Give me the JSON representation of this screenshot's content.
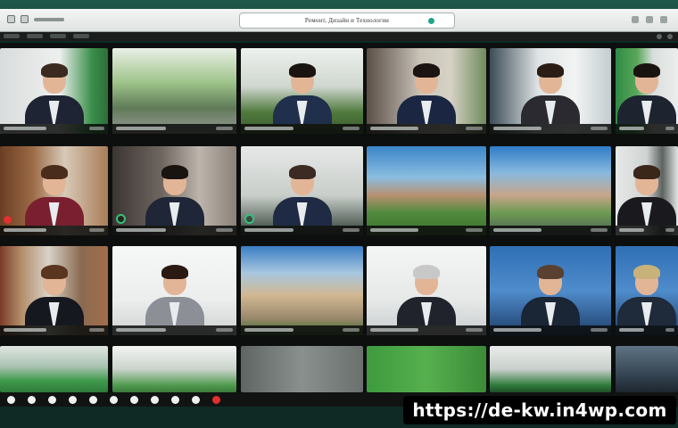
{
  "window": {
    "address_text": "Ремонт, Дизайн и Технологии"
  },
  "watermark": {
    "text": "https://de-kw.in4wp.com"
  },
  "tiles": [
    {
      "id": "r1c1",
      "scene": "office-window",
      "person": true,
      "hair": "#3a2a20",
      "suit": "#1e2433",
      "mic": false
    },
    {
      "id": "r1c2",
      "scene": "greenhouse",
      "person": false
    },
    {
      "id": "r1c3",
      "scene": "garden-hall",
      "person": true,
      "hair": "#1a1410",
      "suit": "#1f2f4c",
      "mic": false
    },
    {
      "id": "r1c4",
      "scene": "cafe",
      "person": true,
      "hair": "#1c1410",
      "suit": "#1b2642",
      "mic": false
    },
    {
      "id": "r1c5",
      "scene": "office-light",
      "person": true,
      "hair": "#2b1d15",
      "suit": "#2a2a30",
      "mic": false
    },
    {
      "id": "r1c6",
      "scene": "green-wall",
      "person": true,
      "hair": "#1a1410",
      "suit": "#1d2430",
      "mic": false
    },
    {
      "id": "r2c1",
      "scene": "library-wood",
      "person": true,
      "hair": "#4a2c1c",
      "suit": "#7a1f30",
      "mic": true,
      "rec": true
    },
    {
      "id": "r2c2",
      "scene": "bookshelf",
      "person": true,
      "hair": "#1a1410",
      "suit": "#1e2638",
      "mic": true
    },
    {
      "id": "r2c3",
      "scene": "studio-grey",
      "person": true,
      "hair": "#3b2b22",
      "suit": "#1f2a44",
      "mic": true
    },
    {
      "id": "r2c4",
      "scene": "park-building",
      "person": false
    },
    {
      "id": "r2c5",
      "scene": "palace",
      "person": false
    },
    {
      "id": "r2c6",
      "scene": "office-frame",
      "person": true,
      "hair": "#3b261a",
      "suit": "#1a1a1e",
      "mic": false
    },
    {
      "id": "r3c1",
      "scene": "library",
      "person": true,
      "hair": "#5a3520",
      "suit": "#161820",
      "mic": false
    },
    {
      "id": "r3c2",
      "scene": "white-room",
      "person": true,
      "hair": "#2a1a12",
      "suit": "#8c8f95",
      "mic": false
    },
    {
      "id": "r3c3",
      "scene": "university",
      "person": false
    },
    {
      "id": "r3c4",
      "scene": "plain-light",
      "person": true,
      "hair": "#c8c8c8",
      "suit": "#20232c",
      "mic": false
    },
    {
      "id": "r3c5",
      "scene": "blue-studio",
      "person": true,
      "hair": "#5a4030",
      "suit": "#1a2536",
      "mic": false
    },
    {
      "id": "r3c6",
      "scene": "blue-studio",
      "person": true,
      "hair": "#c9b27a",
      "suit": "#1f2a3a",
      "mic": false
    },
    {
      "id": "r4c1",
      "scene": "green-floor",
      "person": false
    },
    {
      "id": "r4c2",
      "scene": "atrium",
      "person": false
    },
    {
      "id": "r4c3",
      "scene": "slides-grey",
      "person": false
    },
    {
      "id": "r4c4",
      "scene": "slides-green",
      "person": false
    },
    {
      "id": "r4c5",
      "scene": "dome",
      "person": false
    },
    {
      "id": "r4c6",
      "scene": "night-city",
      "person": false
    }
  ]
}
